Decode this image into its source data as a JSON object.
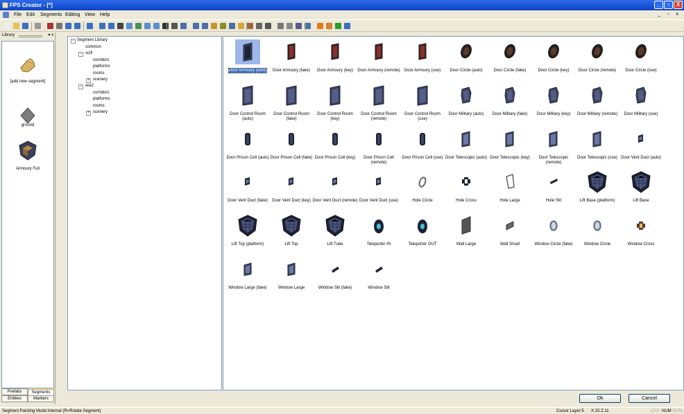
{
  "window": {
    "title": "FPS Creator - [*]",
    "buttons": [
      "_",
      "▫",
      "X"
    ]
  },
  "menu": {
    "items": [
      "File",
      "Edit",
      "Segments",
      "Editing",
      "View",
      "Help"
    ],
    "mdi_buttons": "_ ▫ x"
  },
  "library": {
    "title": "Library",
    "items": [
      {
        "label": "[add new segment]",
        "icon": "hand-icon"
      },
      {
        "label": "ground",
        "icon": "diamond-icon"
      },
      {
        "label": "Armoury Full",
        "icon": "shield-icon"
      }
    ],
    "tabs": {
      "prefabs": "Prefabs",
      "segments": "Segments",
      "entities": "Entities",
      "markers": "Markers"
    }
  },
  "tree": {
    "root": "Segment Library",
    "rows": [
      {
        "label": "common",
        "depth": 1,
        "box": ""
      },
      {
        "label": "scifi",
        "depth": 1,
        "box": "−"
      },
      {
        "label": "corridors",
        "depth": 2,
        "box": ""
      },
      {
        "label": "platforms",
        "depth": 2,
        "box": ""
      },
      {
        "label": "rooms",
        "depth": 2,
        "box": ""
      },
      {
        "label": "scenery",
        "depth": 2,
        "box": "+"
      },
      {
        "label": "ww2",
        "depth": 1,
        "box": "−"
      },
      {
        "label": "corridors",
        "depth": 2,
        "box": ""
      },
      {
        "label": "platforms",
        "depth": 2,
        "box": ""
      },
      {
        "label": "rooms",
        "depth": 2,
        "box": ""
      },
      {
        "label": "scenery",
        "depth": 2,
        "box": "+"
      }
    ]
  },
  "segments": [
    {
      "label": "Door Armoury (auto)",
      "kind": "door-tall",
      "selected": true
    },
    {
      "label": "Door Armoury (fake)",
      "kind": "door-red"
    },
    {
      "label": "Door Armoury (key)",
      "kind": "door-red"
    },
    {
      "label": "Door Armoury (remote)",
      "kind": "door-red"
    },
    {
      "label": "Door Armoury (use)",
      "kind": "door-red"
    },
    {
      "label": "Door Circle (auto)",
      "kind": "circle"
    },
    {
      "label": "Door Circle (fake)",
      "kind": "circle"
    },
    {
      "label": "Door Circle (key)",
      "kind": "circle"
    },
    {
      "label": "Door Circle (remote)",
      "kind": "circle"
    },
    {
      "label": "Door Circle (use)",
      "kind": "circle"
    },
    {
      "label": "Door Control Room (auto)",
      "kind": "panel"
    },
    {
      "label": "Door Control Room (fake)",
      "kind": "panel"
    },
    {
      "label": "Door Control Room (key)",
      "kind": "panel"
    },
    {
      "label": "Door Control Room (remote)",
      "kind": "panel"
    },
    {
      "label": "Door Control Room (use)",
      "kind": "panel"
    },
    {
      "label": "Door Military (auto)",
      "kind": "military"
    },
    {
      "label": "Door Military (fake)",
      "kind": "military"
    },
    {
      "label": "Door Military (key)",
      "kind": "military"
    },
    {
      "label": "Door Military (remote)",
      "kind": "military"
    },
    {
      "label": "Door Military (use)",
      "kind": "military"
    },
    {
      "label": "Door Prison Cell (auto)",
      "kind": "cell"
    },
    {
      "label": "Door Prison Cell (fake)",
      "kind": "cell"
    },
    {
      "label": "Door Prison Cell (key)",
      "kind": "cell"
    },
    {
      "label": "Door Prison Cell (remote)",
      "kind": "cell"
    },
    {
      "label": "Door Prison Cell (use)",
      "kind": "cell"
    },
    {
      "label": "Door Telescopic (auto)",
      "kind": "tele"
    },
    {
      "label": "Door Telescopic (key)",
      "kind": "tele"
    },
    {
      "label": "Door Telescopic (remote)",
      "kind": "tele"
    },
    {
      "label": "Door Telescopic (use)",
      "kind": "tele"
    },
    {
      "label": "Door Vent Duct (auto)",
      "kind": "vent"
    },
    {
      "label": "Door Vent Duct (fake)",
      "kind": "vent"
    },
    {
      "label": "Door Vent Duct (key)",
      "kind": "vent"
    },
    {
      "label": "Door Vent Duct (remote)",
      "kind": "vent"
    },
    {
      "label": "Door Vent Duct (use)",
      "kind": "vent"
    },
    {
      "label": "Hole Circle",
      "kind": "ring"
    },
    {
      "label": "Hole Cross",
      "kind": "cross"
    },
    {
      "label": "Hole Large",
      "kind": "outline"
    },
    {
      "label": "Hole Slit",
      "kind": "slit"
    },
    {
      "label": "Lift Base (platform)",
      "kind": "lift"
    },
    {
      "label": "Lift Base",
      "kind": "lift"
    },
    {
      "label": "Lift Top (platform)",
      "kind": "lift"
    },
    {
      "label": "Lift Top",
      "kind": "lift"
    },
    {
      "label": "Lift Tube",
      "kind": "lift"
    },
    {
      "label": "Teleporter IN",
      "kind": "teleporter"
    },
    {
      "label": "Teleporter OUT",
      "kind": "teleporter"
    },
    {
      "label": "Wall Large",
      "kind": "wall"
    },
    {
      "label": "Wall Small",
      "kind": "wall-small"
    },
    {
      "label": "Window Circle (fake)",
      "kind": "window-oval"
    },
    {
      "label": "Window Circle",
      "kind": "window-oval"
    },
    {
      "label": "Window Cross",
      "kind": "window-cross"
    },
    {
      "label": "Window Large (fake)",
      "kind": "window-large"
    },
    {
      "label": "Window Large",
      "kind": "window-large"
    },
    {
      "label": "Window Slit (fake)",
      "kind": "window-slit"
    },
    {
      "label": "Window Slit",
      "kind": "window-slit"
    }
  ],
  "buttons": {
    "ok": "Ok",
    "cancel": "Cancel"
  },
  "status": {
    "mode": "Segment Painting Mode:Internal (R=Rotate Segment)",
    "cursor": "Cursor Layer:5",
    "coords": "X:15  Z:11",
    "caps": "CAP",
    "num": "NUM",
    "scrl": "SCRL"
  }
}
